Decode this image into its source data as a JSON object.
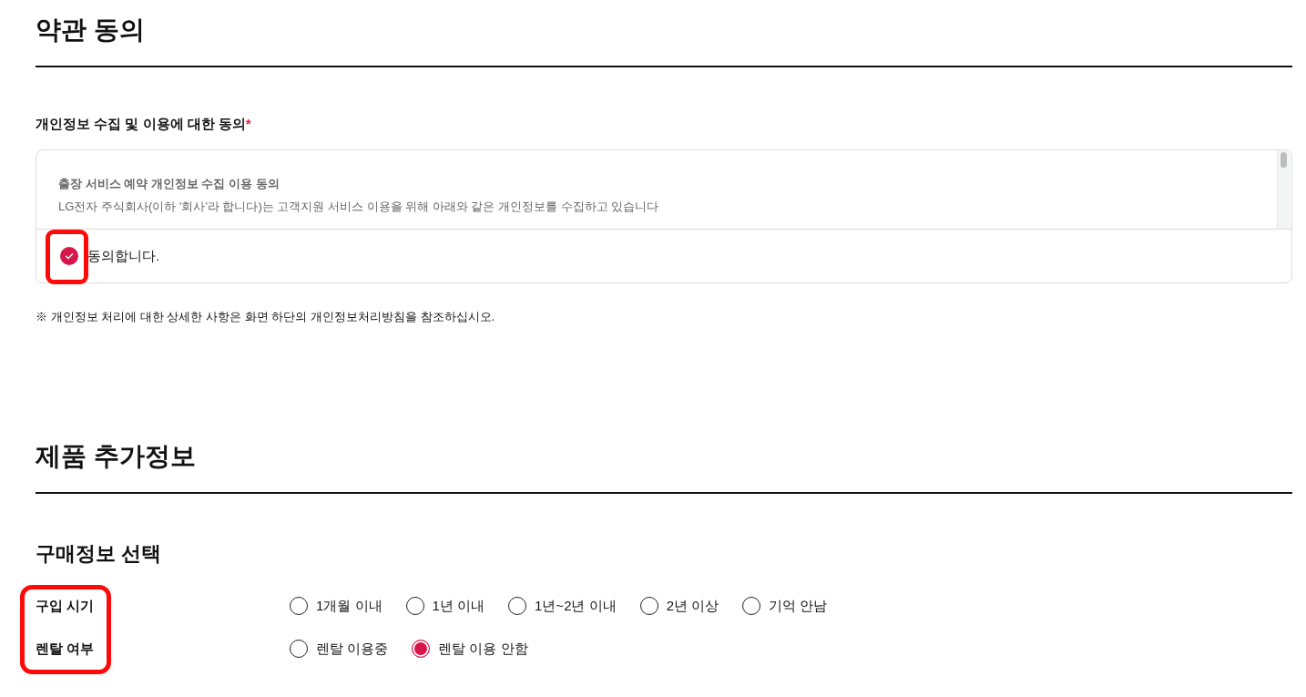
{
  "terms": {
    "title": "약관 동의",
    "consent": {
      "title": "개인정보 수집 및 이용에 대한 동의",
      "required_mark": "*",
      "heading": "출장 서비스 예약 개인정보 수집 이용 동의",
      "body": "LG전자 주식회사(이하 '회사'라 합니다)는 고객지원 서비스 이용을 위해 아래와 같은 개인정보를 수집하고 있습니다",
      "agree": {
        "label": "동의합니다.",
        "checked": true,
        "highlighted": true
      }
    },
    "note": "※ 개인정보 처리에 대한 상세한 사항은 화면 하단의 개인정보처리방침을 참조하십시오."
  },
  "product_info": {
    "title": "제품 추가정보",
    "purchase_info": {
      "title": "구매정보 선택",
      "labels_highlighted": true,
      "rows": [
        {
          "label": "구입 시기",
          "options": [
            {
              "label": "1개월 이내",
              "selected": false
            },
            {
              "label": "1년 이내",
              "selected": false
            },
            {
              "label": "1년~2년 이내",
              "selected": false
            },
            {
              "label": "2년 이상",
              "selected": false
            },
            {
              "label": "기억 안남",
              "selected": false
            }
          ]
        },
        {
          "label": "렌탈 여부",
          "options": [
            {
              "label": "렌탈 이용중",
              "selected": false
            },
            {
              "label": "렌탈 이용 안함",
              "selected": true
            }
          ]
        }
      ]
    }
  }
}
